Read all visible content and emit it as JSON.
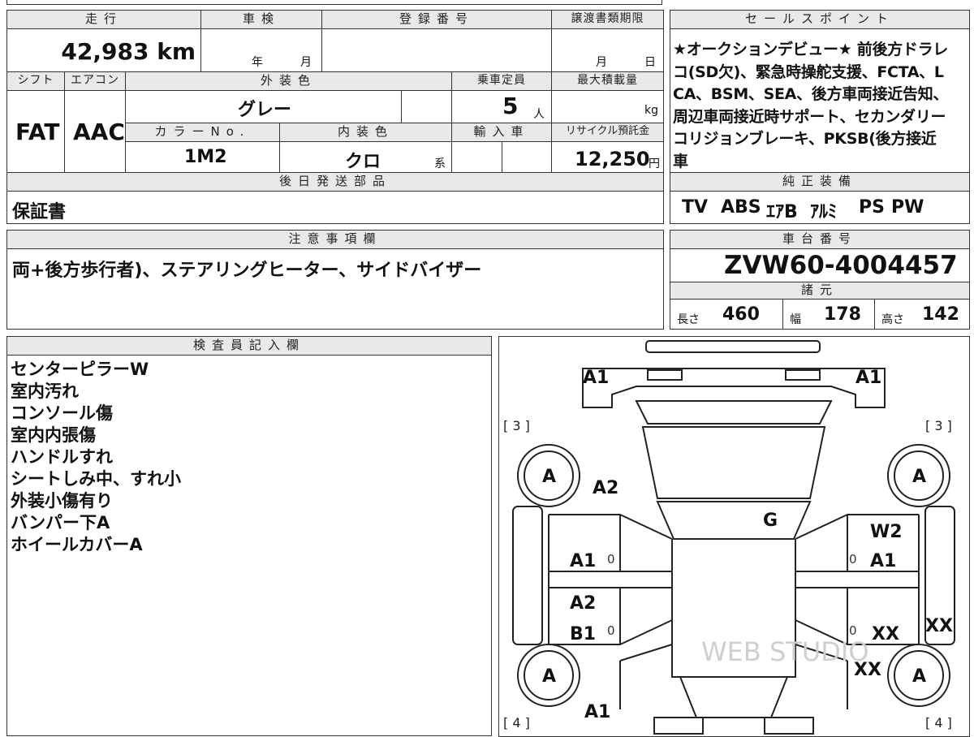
{
  "vehicle": {
    "mileage_header": "走行",
    "mileage": "42,983 km",
    "shaken_header": "車検",
    "shaken_year": "年",
    "shaken_month": "月",
    "reg_header": "登録番号",
    "transfer_header": "譲渡書類期限",
    "transfer_month": "月",
    "transfer_day": "日",
    "shift_header": "シフト",
    "shift": "FAT",
    "ac_header": "エアコン",
    "ac": "AAC",
    "exterior_header": "外装色",
    "exterior": "グレー",
    "capacity_header": "乗車定員",
    "capacity": "5",
    "capacity_unit": "人",
    "maxload_header": "最大積載量",
    "maxload_unit": "kg",
    "color_no_header": "カラーNo.",
    "color_no": "1M2",
    "interior_header": "内装色",
    "interior": "クロ",
    "interior_unit": "系",
    "import_header": "輸入車",
    "recycle_header": "リサイクル預託金",
    "recycle": "12,250",
    "recycle_unit": "円",
    "later_parts_header": "後日発送部品",
    "later_parts": "保証書"
  },
  "sales_points": {
    "header": "セールスポイント",
    "text": "★オークションデビュー★ 前後方ドラレコ(SD欠)、緊急時操舵支援、FCTA、LCA、BSM、SEA、後方車両接近告知、周辺車両接近時サポート、セカンダリーコリジョンブレーキ、PKSB(後方接近車"
  },
  "equipment": {
    "header": "純正装備",
    "items": [
      "TV",
      "ABS",
      "ｴｱB",
      "ｱﾙﾐ",
      "PS",
      "PW"
    ]
  },
  "notes": {
    "header": "注意事項欄",
    "text": "両+後方歩行者)、ステアリングヒーター、サイドバイザー"
  },
  "chassis": {
    "header": "車台番号",
    "number": "ZVW60-4004457"
  },
  "specs": {
    "header": "諸元",
    "length_label": "長さ",
    "length": "460",
    "width_label": "幅",
    "width": "178",
    "height_label": "高さ",
    "height": "142"
  },
  "inspector": {
    "header": "検査員記入欄",
    "lines": [
      "センターピラーW",
      "室内汚れ",
      "コンソール傷",
      "室内内張傷",
      "ハンドルすれ",
      "シートしみ中、すれ小",
      "外装小傷有り",
      "バンパー下A",
      "ホイールカバーA"
    ]
  },
  "diagram": {
    "marks": {
      "front_left": "A1",
      "front_right": "A1",
      "tire_fl": "A",
      "tire_fr": "A",
      "tire_rl": "A",
      "tire_rr": "A",
      "fender_fl": "A2",
      "roof": "G",
      "door_fl": "A1",
      "door_fr": "A1",
      "door_fr_top": "W2",
      "door_rl_top": "A2",
      "door_rl": "B1",
      "door_rr": "XX",
      "side_r": "XX",
      "rear_fender_r": "XX",
      "rear_left": "A1"
    },
    "zeros": [
      "0",
      "0",
      "0",
      "0"
    ],
    "bracket_tl": "3",
    "bracket_tr": "3",
    "bracket_bl": "4",
    "bracket_br": "4",
    "watermark": "WEB STUDIO"
  }
}
